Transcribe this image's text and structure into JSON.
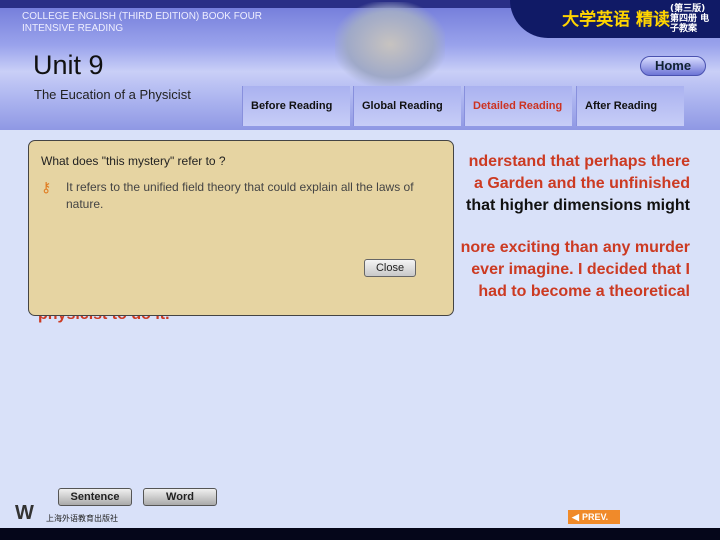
{
  "header": {
    "college": "COLLEGE ENGLISH (THIRD EDITION) BOOK FOUR",
    "college2": "INTENSIVE READING",
    "cn_title": "大学英语 精读",
    "cn_sub": "(第三版) 第四册 电子教案",
    "unit": "Unit 9",
    "subtitle": "The Eucation of a Physicist",
    "home": "Home"
  },
  "tabs": [
    {
      "label": "Before Reading"
    },
    {
      "label": "Global Reading"
    },
    {
      "label": "Detailed Reading",
      "active": true
    },
    {
      "label": "After Reading"
    }
  ],
  "text": {
    "p1": [
      "nderstand that perhaps there",
      "a Garden and the unfinished",
      "that higher dimensions might"
    ],
    "p2": [
      "nore exciting than any murder",
      "ever imagine. I decided that I",
      "had to become a theoretical"
    ],
    "p3": "physicist to do it."
  },
  "popup": {
    "question": "What does \"this mystery\" refer to ?",
    "answer": "It refers to the unified field theory that could explain all the laws of nature.",
    "close": "Close",
    "icon": "key-icon"
  },
  "footer": {
    "sentence": "Sentence",
    "word": "Word",
    "publisher": "上海外语教育出版社",
    "logo": "W",
    "prev": "PREV."
  },
  "colors": {
    "accent_text": "#cc3a22",
    "popup_bg": "#e6d4a2",
    "prev_bg": "#f08a2a"
  }
}
